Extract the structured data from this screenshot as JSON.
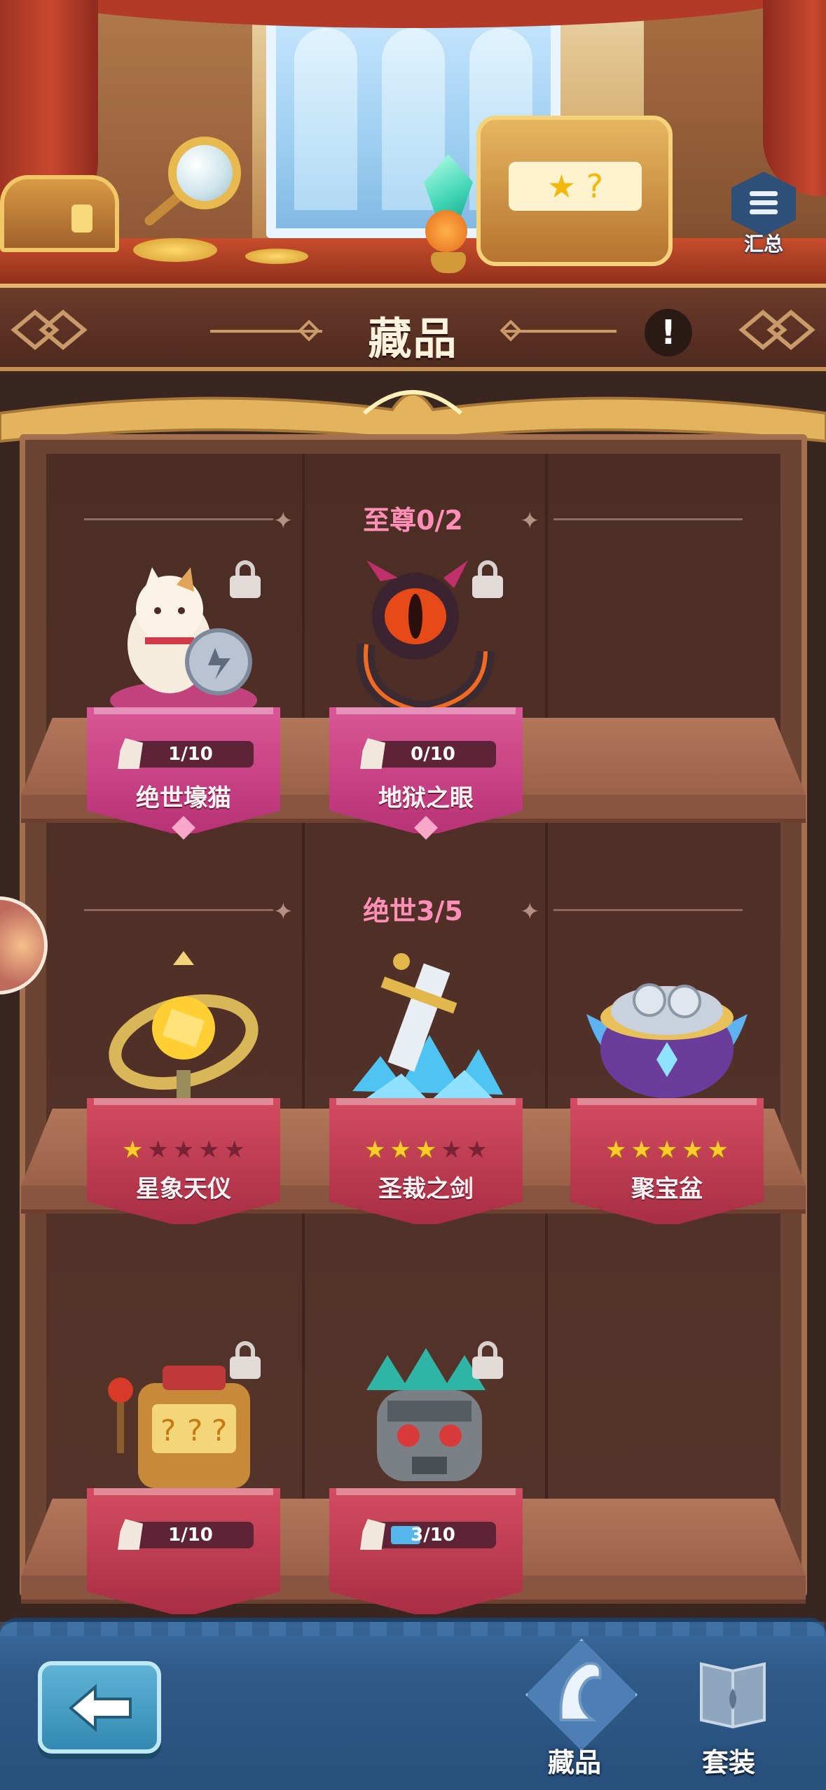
{
  "header": {
    "title": "藏品",
    "info_label": "!",
    "summary_label": "汇总"
  },
  "sections": [
    {
      "title": "至尊0/2",
      "items": [
        {
          "name": "绝世壕猫",
          "progress": "1/10",
          "locked": true,
          "progress_fraction": 0.1
        },
        {
          "name": "地狱之眼",
          "progress": "0/10",
          "locked": true,
          "progress_fraction": 0.0
        }
      ]
    },
    {
      "title": "绝世3/5",
      "items": [
        {
          "name": "星象天仪",
          "stars": 1,
          "max_stars": 5
        },
        {
          "name": "圣裁之剑",
          "stars": 3,
          "max_stars": 5
        },
        {
          "name": "聚宝盆",
          "stars": 5,
          "max_stars": 5
        }
      ]
    },
    {
      "title": "",
      "items": [
        {
          "progress": "1/10",
          "locked": true,
          "progress_fraction": 0.1
        },
        {
          "progress": "3/10",
          "locked": true,
          "progress_fraction": 0.3
        }
      ]
    }
  ],
  "bottom_nav": {
    "back_icon": "arrow-left-icon",
    "tabs": [
      {
        "label": "藏品",
        "active": true,
        "icon": "harp-icon"
      },
      {
        "label": "套装",
        "active": false,
        "icon": "book-icon"
      }
    ]
  },
  "colors": {
    "section_title": "#ff8fb6",
    "plaque_supreme": "#d95796",
    "plaque_peerless": "#d34c61",
    "star_on": "#ffcc2a",
    "nav_bg": "#2f5a88"
  }
}
